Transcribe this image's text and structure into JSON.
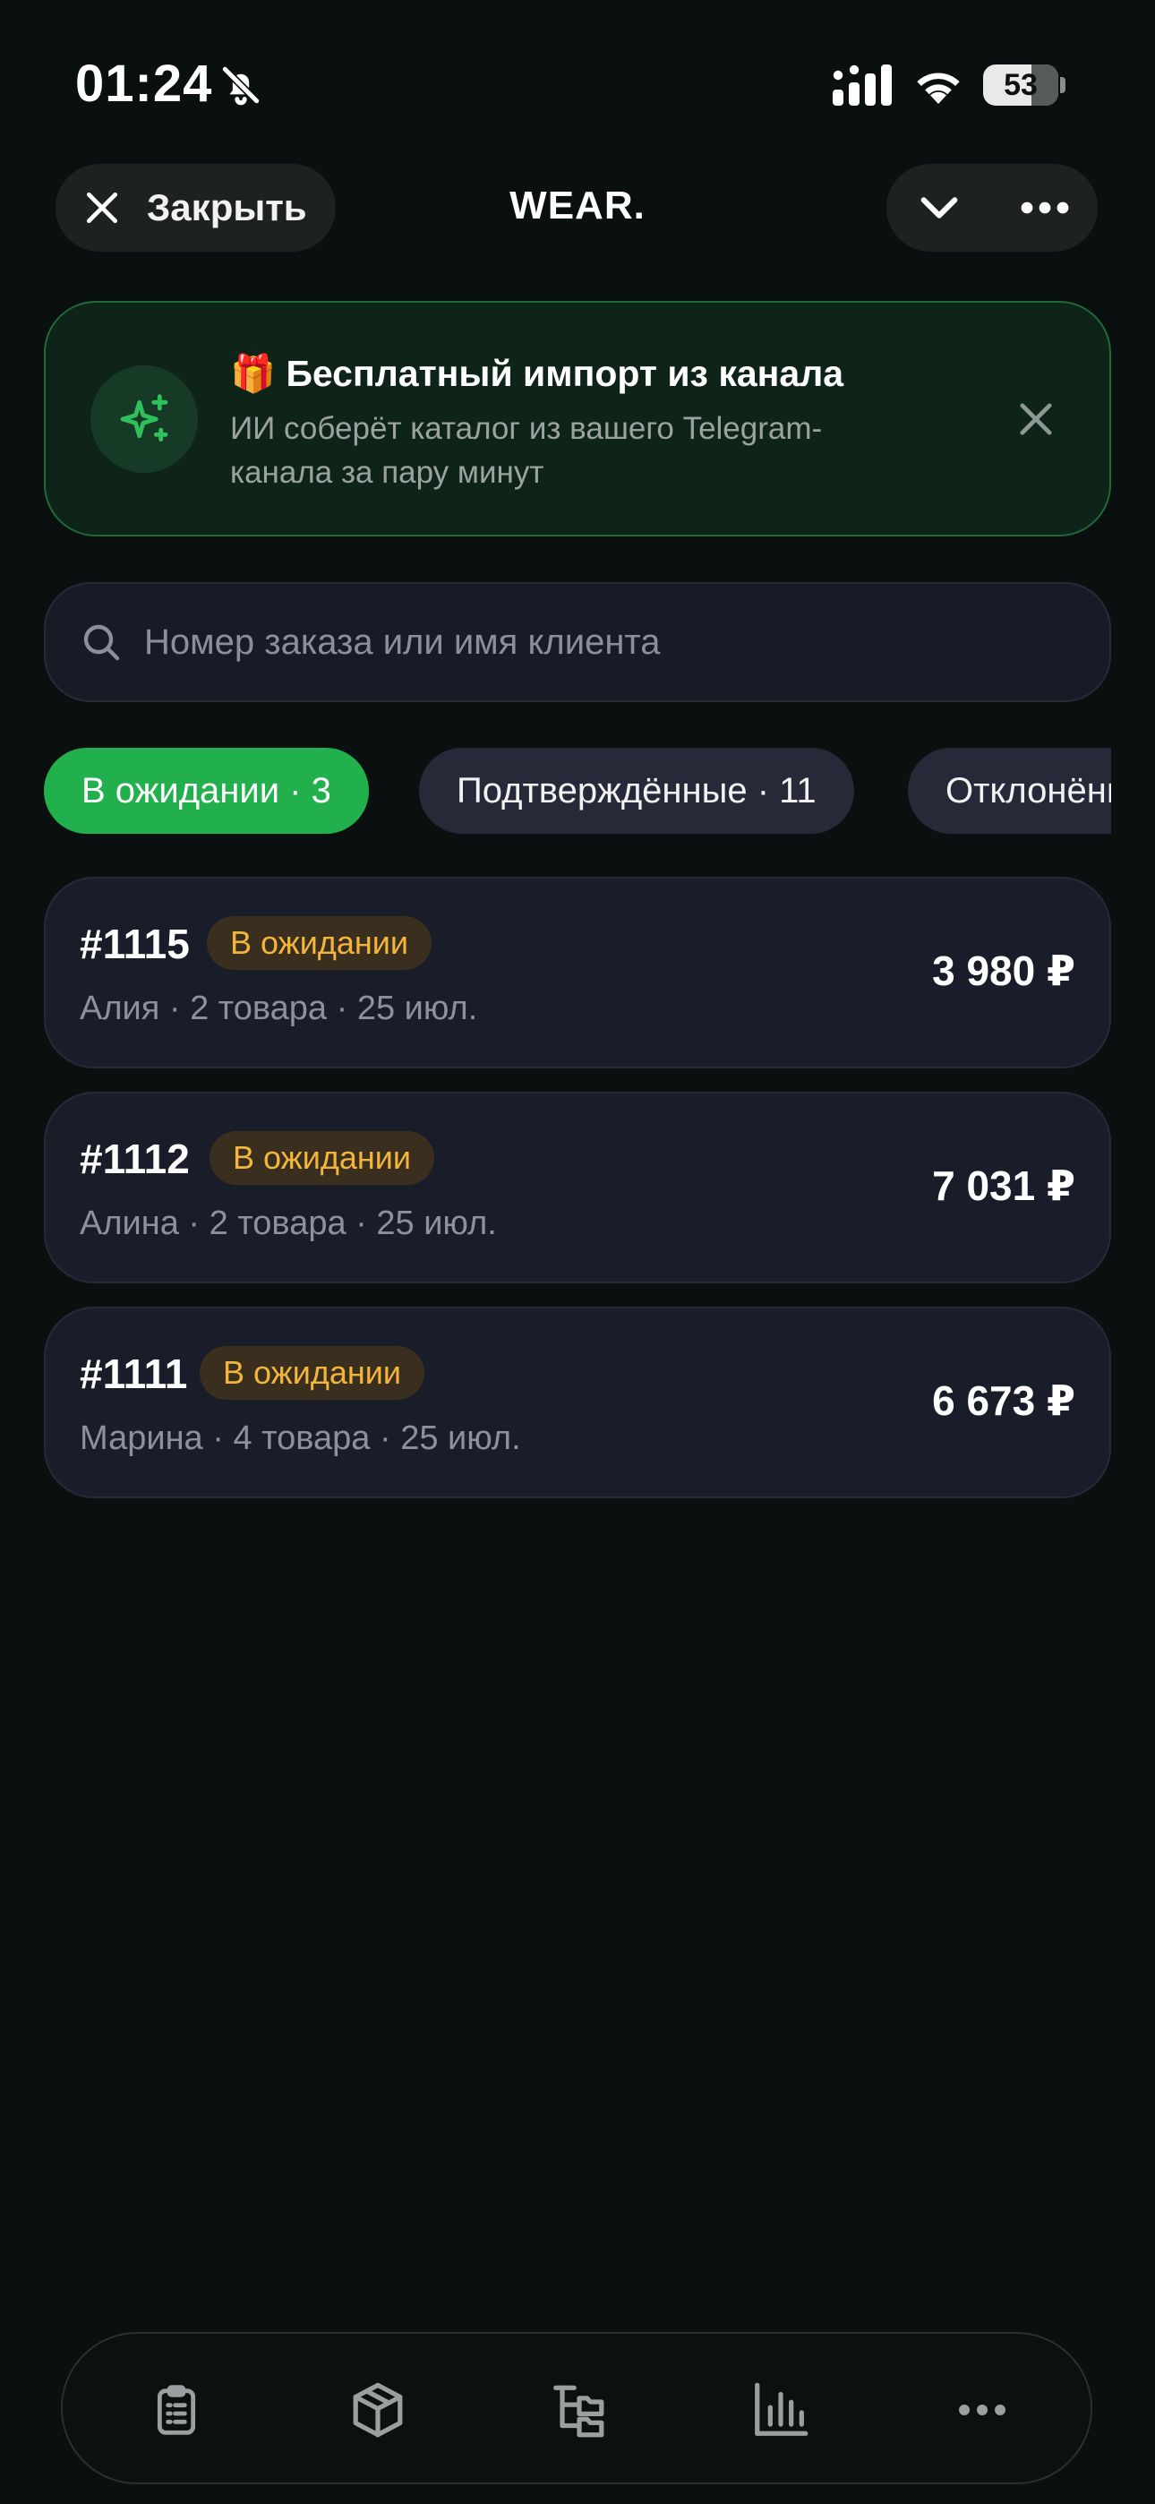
{
  "status_bar": {
    "time": "01:24",
    "battery": "53",
    "icons": [
      "bell-slash-icon",
      "signal-icon",
      "wifi-icon",
      "battery-icon"
    ]
  },
  "header": {
    "close_label": "Закрыть",
    "title": "WEAR.",
    "icons": [
      "close-icon",
      "chevron-down-icon",
      "more-icon"
    ]
  },
  "banner": {
    "title": "🎁 Бесплатный импорт из канала",
    "subtitle": "ИИ соберёт каталог из вашего Telegram-канала за пару минут",
    "icon": "sparkles-icon"
  },
  "search": {
    "placeholder": "Номер заказа или имя клиента",
    "value": ""
  },
  "filters": [
    {
      "label": "В ожидании · 3",
      "active": true
    },
    {
      "label": "Подтверждённые · 11",
      "active": false
    },
    {
      "label": "Отклонённые",
      "active": false
    }
  ],
  "orders": [
    {
      "id": "#1115",
      "status": "В ожидании",
      "meta": "Алия · 2 товара · 25 июл.",
      "amount": "3 980 ₽"
    },
    {
      "id": "#1112",
      "status": "В ожидании",
      "meta": "Алина · 2 товара · 25 июл.",
      "amount": "7 031 ₽"
    },
    {
      "id": "#1111",
      "status": "В ожидании",
      "meta": "Марина · 4 товара · 25 июл.",
      "amount": "6 673 ₽"
    }
  ],
  "tabbar": {
    "icons": [
      "clipboard-icon",
      "box-icon",
      "tree-icon",
      "chart-icon",
      "more-icon"
    ]
  },
  "colors": {
    "background": "#0a100f",
    "accent": "#22b04d",
    "pending": "#f4b63a",
    "card": "#191c29"
  }
}
